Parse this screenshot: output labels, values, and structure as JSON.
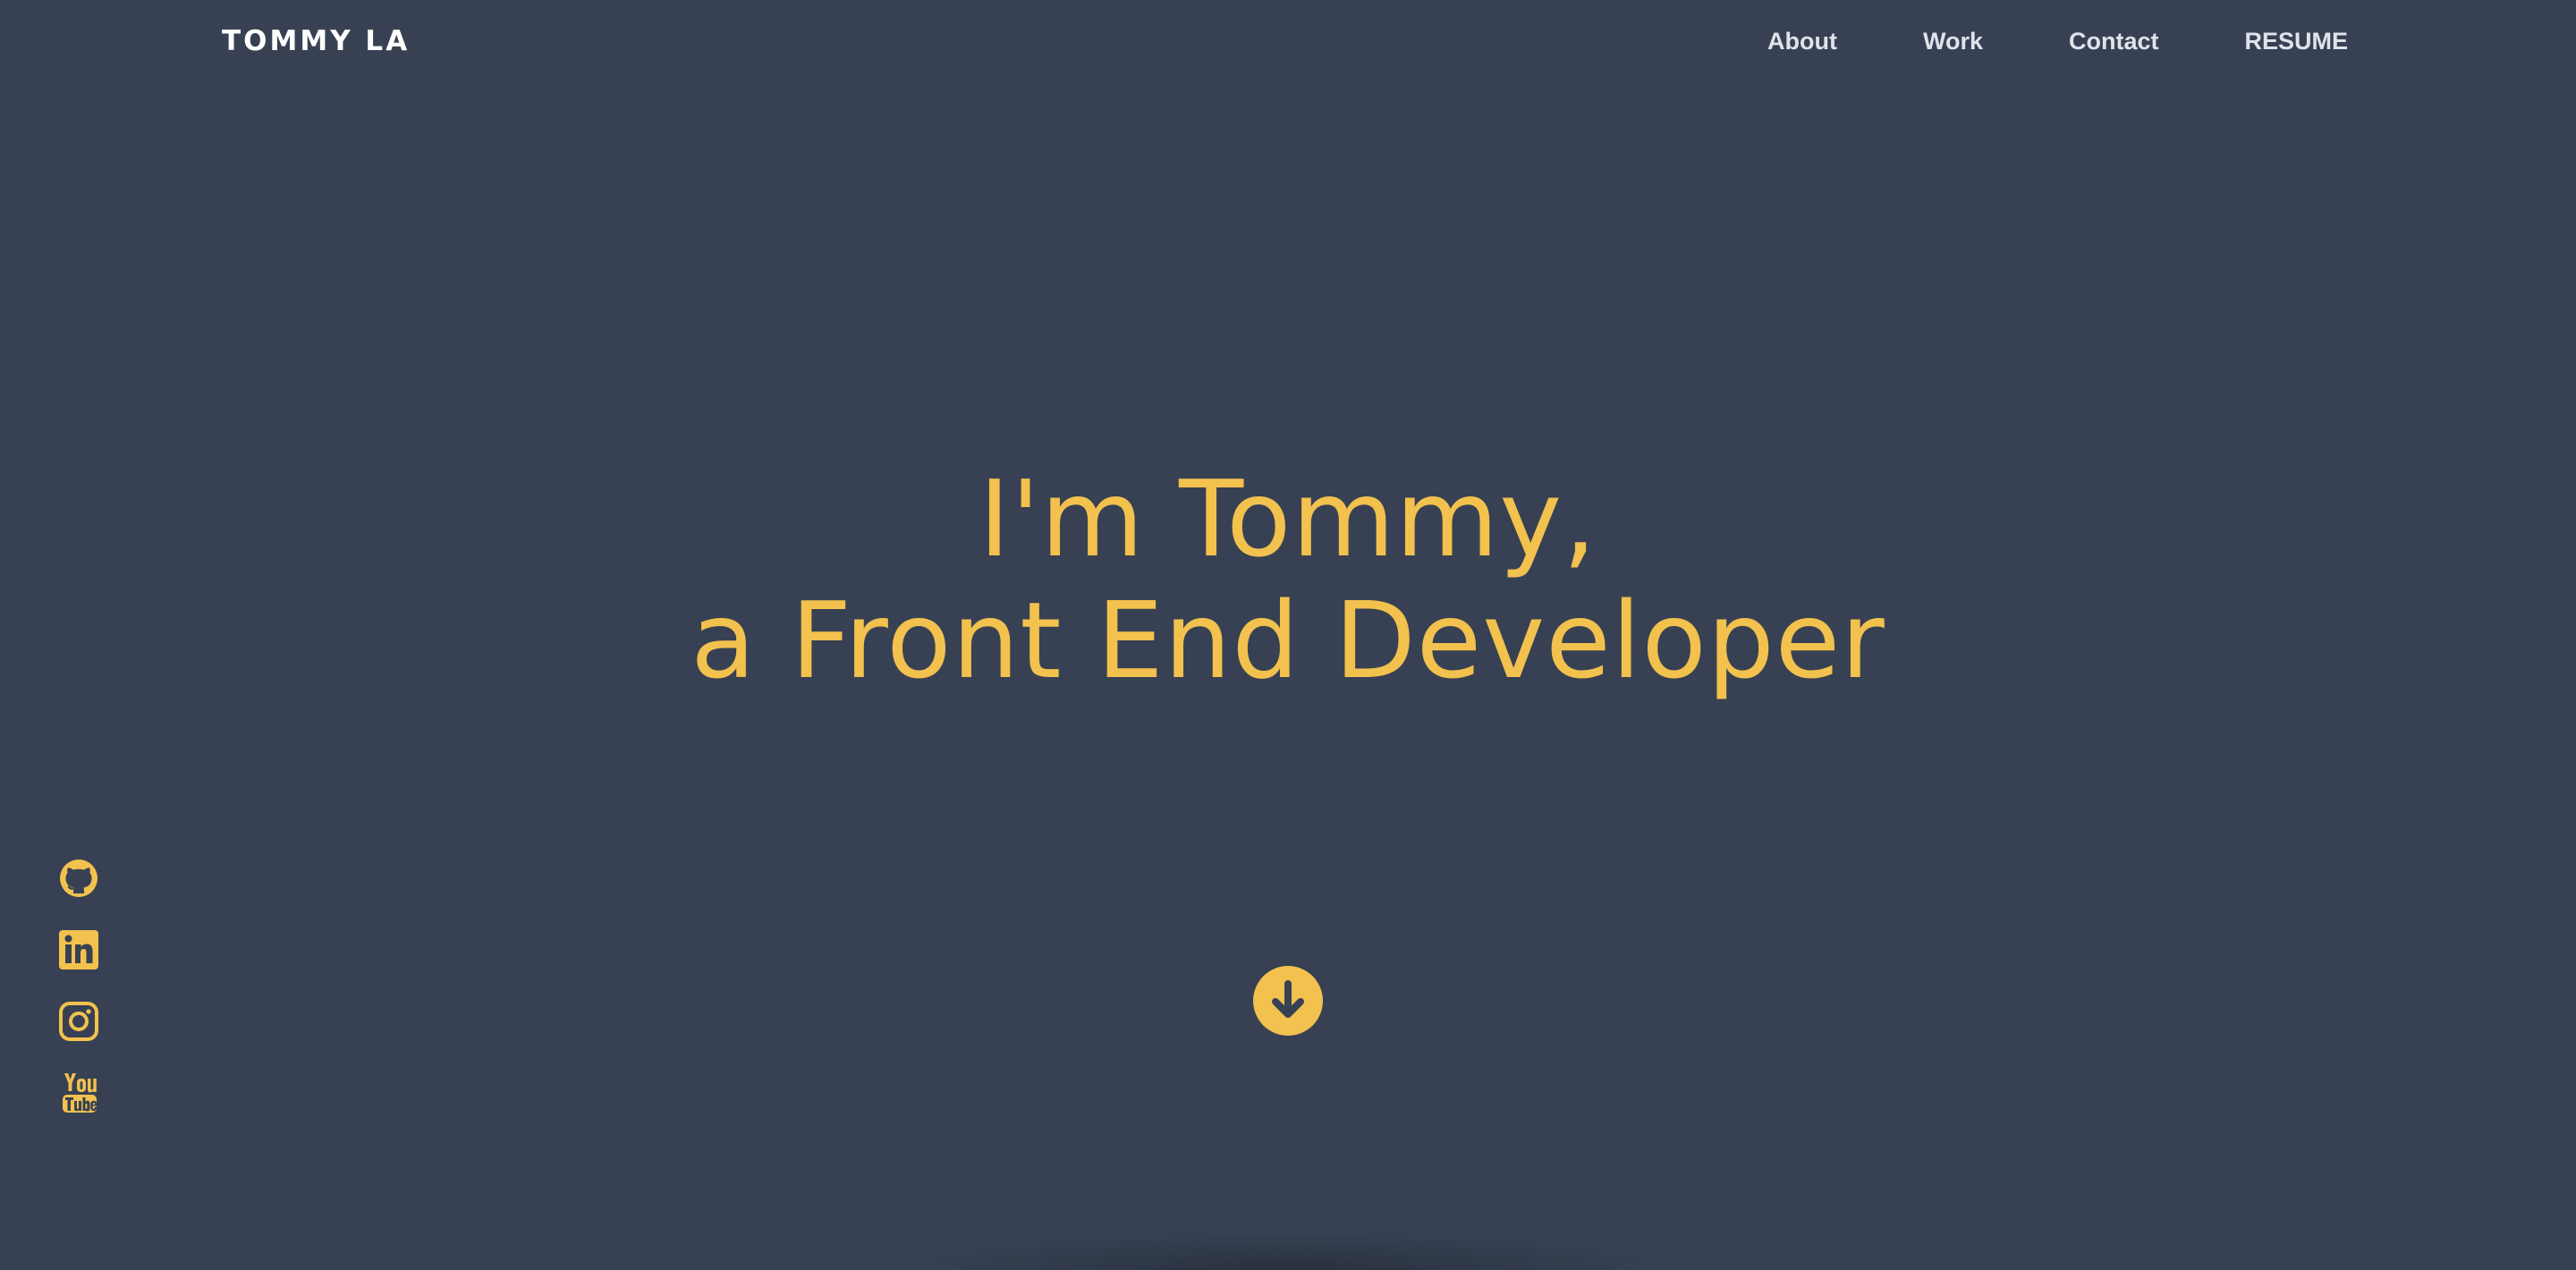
{
  "header": {
    "brand": "TOMMY LA",
    "nav": [
      {
        "label": "About"
      },
      {
        "label": "Work"
      },
      {
        "label": "Contact"
      },
      {
        "label": "RESUME"
      }
    ]
  },
  "hero": {
    "line1": "I'm Tommy,",
    "line2": "a Front End Developer"
  },
  "social": [
    {
      "icon": "github-icon"
    },
    {
      "icon": "linkedin-icon"
    },
    {
      "icon": "instagram-icon"
    },
    {
      "icon": "youtube-icon"
    }
  ],
  "scroll_button": {
    "icon": "arrow-down-icon"
  },
  "colors": {
    "background": "#374153",
    "accent": "#f2c14e",
    "brand_text": "#ffffff",
    "nav_text": "#dfe3ea"
  }
}
